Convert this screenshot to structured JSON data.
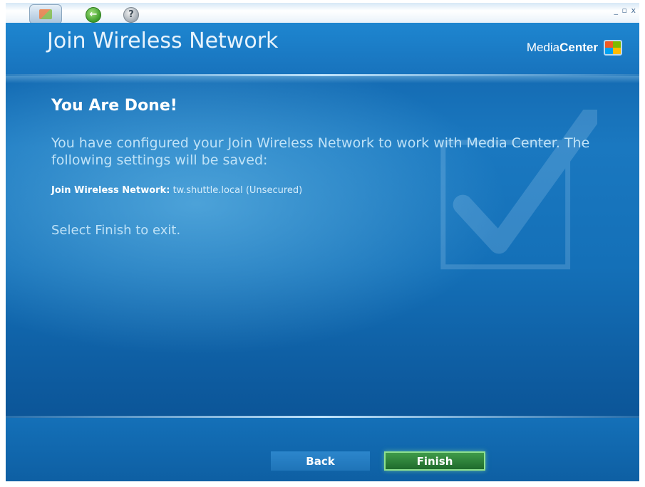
{
  "window": {
    "controls": "_ ▫ x"
  },
  "toolbar": {
    "start_icon": "windows-start-icon",
    "back_icon": "back-arrow-icon",
    "help_icon": "help-icon",
    "back_glyph": "←",
    "help_glyph": "?"
  },
  "header": {
    "title": "Join Wireless Network",
    "brand_prefix": "Media",
    "brand_bold": "Center",
    "brand_logo": "windows-flag-logo"
  },
  "content": {
    "heading": "You Are Done!",
    "message": "You have configured your Join Wireless Network to work with Media Center. The following settings will be saved:",
    "setting_label": "Join Wireless Network:",
    "setting_value": "tw.shuttle.local (Unsecured)",
    "exit_note": "Select Finish to exit.",
    "background_icon": "checkmark-icon"
  },
  "footer": {
    "back_label": "Back",
    "finish_label": "Finish"
  },
  "colors": {
    "background": "#1470b8",
    "header_text": "#e7f3fc",
    "message_text": "#bfe2f7",
    "finish_button": "#2a7d36",
    "finish_border": "#8ee08f"
  }
}
